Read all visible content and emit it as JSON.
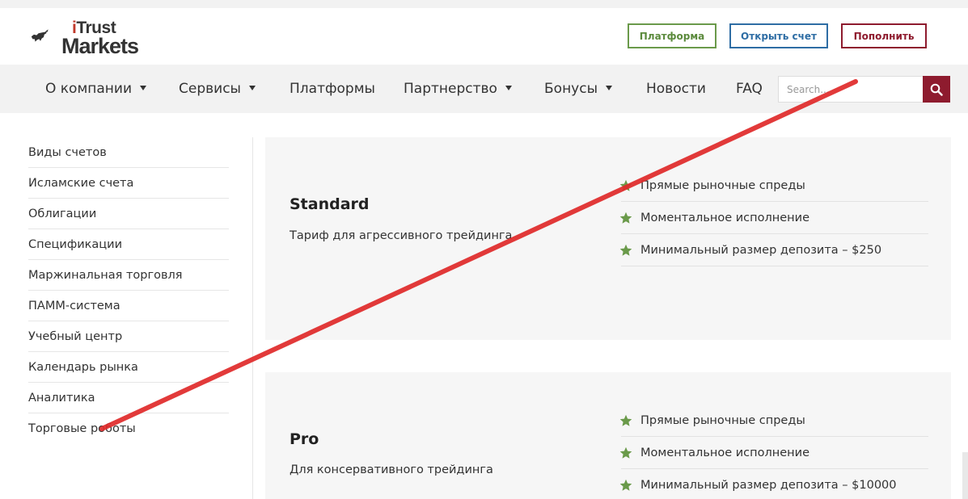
{
  "header": {
    "logo": {
      "trust_i": "i",
      "trust": "Trust",
      "markets": "Markets"
    },
    "buttons": {
      "platform": "Платформа",
      "open_account": "Открыть счет",
      "fund": "Пополнить"
    }
  },
  "nav": {
    "items": [
      {
        "label": "О компании",
        "dropdown": true
      },
      {
        "label": "Сервисы",
        "dropdown": true
      },
      {
        "label": "Платформы",
        "dropdown": false
      },
      {
        "label": "Партнерство",
        "dropdown": true
      },
      {
        "label": "Бонусы",
        "dropdown": true
      },
      {
        "label": "Новости",
        "dropdown": false
      },
      {
        "label": "FAQ",
        "dropdown": false
      }
    ],
    "search_placeholder": "Search...",
    "search_icon": "search-icon"
  },
  "sidebar": {
    "items": [
      "Виды счетов",
      "Исламские счета",
      "Облигации",
      "Спецификации",
      "Маржинальная торговля",
      "ПАММ-система",
      "Учебный центр",
      "Календарь рынка",
      "Аналитика",
      "Торговые роботы"
    ]
  },
  "accounts": [
    {
      "title": "Standard",
      "subtitle": "Тариф для агрессивного трейдинга",
      "features": [
        "Прямые рыночные спреды",
        "Моментальное исполнение",
        "Минимальный размер депозита – $250"
      ]
    },
    {
      "title": "Pro",
      "subtitle": "Для консервативного трейдинга",
      "features": [
        "Прямые рыночные спреды",
        "Моментальное исполнение",
        "Минимальный размер депозита – $10000"
      ]
    }
  ],
  "colors": {
    "brand_red": "#8e1b2e",
    "green": "#5b8a3c",
    "blue": "#2e6da4",
    "star": "#6a9a4a",
    "annotation_line": "#e02a2a"
  }
}
